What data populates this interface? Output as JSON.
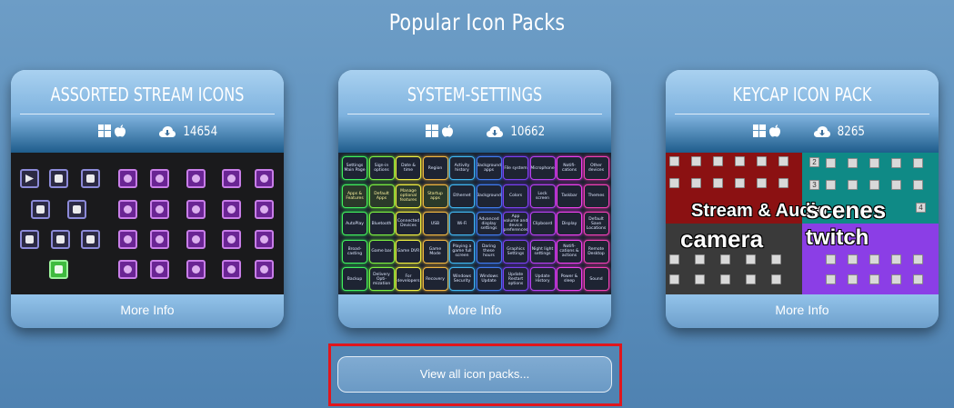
{
  "page": {
    "title": "Popular Icon Packs"
  },
  "cards": [
    {
      "title": "ASSORTED STREAM ICONS",
      "downloads": "14654",
      "more_info": "More Info",
      "platforms": [
        "windows-icon",
        "apple-icon"
      ]
    },
    {
      "title": "SYSTEM-SETTINGS",
      "downloads": "10662",
      "more_info": "More Info",
      "platforms": [
        "windows-icon",
        "apple-icon"
      ]
    },
    {
      "title": "KEYCAP ICON PACK",
      "downloads": "8265",
      "more_info": "More Info",
      "platforms": [
        "windows-icon",
        "apple-icon"
      ]
    }
  ],
  "system_settings_labels": [
    "Settings Main Page",
    "Sign-in options",
    "Date & time",
    "Region",
    "Activity history",
    "Background apps",
    "File system",
    "Microphone",
    "Notifi- cations",
    "Other devices",
    "Apps & Features",
    "Default Apps",
    "Manage optional features",
    "Startup apps",
    "Ethernet",
    "Background",
    "Colors",
    "Lock screen",
    "Taskbar",
    "Themes",
    "AutoPlay",
    "Bluetooth",
    "Connected Devices",
    "USB",
    "Wi-Fi",
    "Advanced display settings",
    "App volume and device preferences",
    "Clipboard",
    "Display",
    "Default Save Locations",
    "Broad- casting",
    "Game bar",
    "Game DVR",
    "Game Mode",
    "Playing a game full screen",
    "Daring these hours",
    "Graphics Settings",
    "Night light settings",
    "Notifi- cations & actions",
    "Remote Desktop",
    "Backup",
    "Delivery Opti- mization",
    "For developers",
    "Recovery",
    "Windows Security",
    "Windows Update",
    "Update Restart options",
    "Update History",
    "Power & sleep",
    "Sound"
  ],
  "keycap_bands": [
    "Stream & Audio",
    "scenes",
    "camera",
    "twitch"
  ],
  "keycap_numbers": [
    "2",
    "3",
    "4"
  ],
  "view_all": {
    "label": "View all icon packs..."
  },
  "colors": {
    "accent_red": "#e0161d",
    "pack3_red": "#8b1112",
    "pack3_teal": "#0f8a86",
    "pack3_purple": "#8b3ee6"
  }
}
